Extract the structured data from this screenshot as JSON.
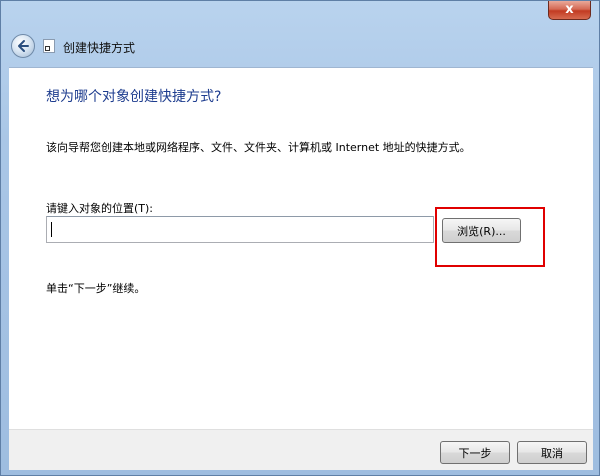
{
  "window": {
    "title": "创建快捷方式",
    "close_glyph": "x",
    "accent_color": "#1e3d8f",
    "highlight_color": "#e00000"
  },
  "icons": {
    "back": "back-arrow-icon",
    "shortcut": "shortcut-icon"
  },
  "wizard": {
    "heading": "想为哪个对象创建快捷方式?",
    "description": "该向导帮您创建本地或网络程序、文件、文件夹、计算机或 Internet 地址的快捷方式。",
    "input_label": "请键入对象的位置(T):",
    "input_value": "",
    "browse_label": "浏览(R)...",
    "hint": "单击“下一步”继续。"
  },
  "footer": {
    "next_label": "下一步",
    "cancel_label": "取消"
  }
}
